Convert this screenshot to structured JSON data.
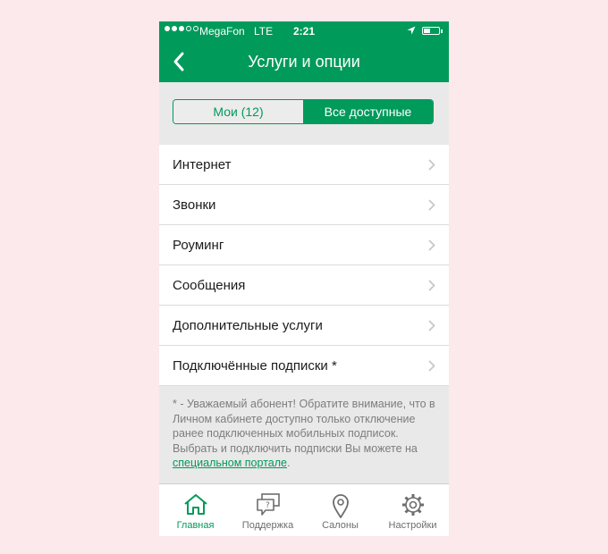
{
  "status_bar": {
    "carrier": "MegaFon",
    "network": "LTE",
    "time": "2:21",
    "battery_level": 0.45
  },
  "nav": {
    "title": "Услуги и опции"
  },
  "segments": [
    {
      "label": "Мои (12)",
      "active": false
    },
    {
      "label": "Все доступные",
      "active": true
    }
  ],
  "list_items": [
    {
      "label": "Интернет"
    },
    {
      "label": "Звонки"
    },
    {
      "label": "Роуминг"
    },
    {
      "label": "Сообщения"
    },
    {
      "label": "Дополнительные услуги"
    },
    {
      "label": "Подключённые подписки *"
    }
  ],
  "note": {
    "text": "* - Уважаемый абонент! Обратите внимание, что в Личном кабинете доступно только отключение ранее подключенных мобильных подписок. Выбрать и подключить подписки Вы можете на ",
    "link_text": "специальном портале",
    "suffix": "."
  },
  "tabs": [
    {
      "label": "Главная",
      "icon": "home-icon",
      "active": true
    },
    {
      "label": "Поддержка",
      "icon": "support-chat-icon",
      "active": false
    },
    {
      "label": "Салоны",
      "icon": "map-pin-icon",
      "active": false
    },
    {
      "label": "Настройки",
      "icon": "gear-icon",
      "active": false
    }
  ],
  "colors": {
    "brand": "#009a5b",
    "background": "#e9e9e9",
    "page_background": "#fce9ec"
  }
}
